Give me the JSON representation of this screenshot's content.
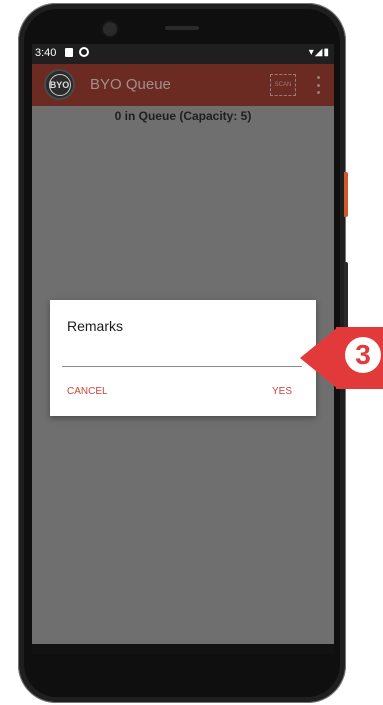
{
  "statusbar": {
    "time": "3:40",
    "icons": [
      "sim-icon",
      "sync-icon"
    ],
    "right_icons": [
      "wifi-icon",
      "signal-icon",
      "battery-icon"
    ]
  },
  "appbar": {
    "logo_text": "BYO",
    "title": "BYO Queue",
    "scan_label": "SCAN",
    "accent_color": "#6b2a22"
  },
  "queue": {
    "summary": "0 in Queue (Capacity: 5)"
  },
  "dialog": {
    "title": "Remarks",
    "input_value": "",
    "cancel_label": "CANCEL",
    "yes_label": "YES",
    "button_color": "#d0433b"
  },
  "navbar": {
    "icons": [
      "back-icon",
      "home-icon",
      "recents-icon"
    ]
  },
  "annotation": {
    "step_number": "3",
    "color": "#e23a3a"
  }
}
